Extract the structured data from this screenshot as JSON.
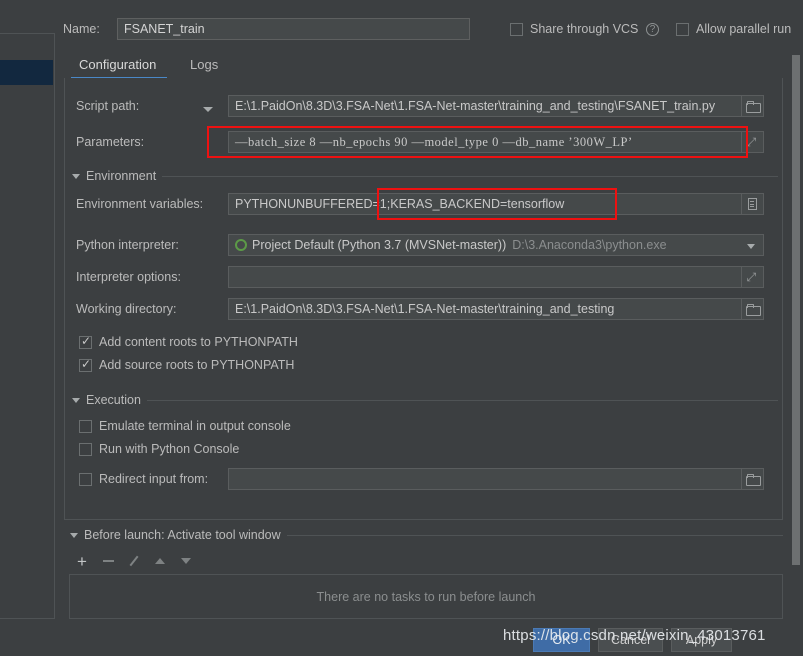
{
  "window": {
    "name_label": "Name:",
    "name_value": "FSANET_train",
    "share_vcs_label": "Share through VCS",
    "share_vcs_checked": false,
    "help_glyph": "?",
    "allow_parallel_label": "Allow parallel run",
    "allow_parallel_checked": false
  },
  "tabs": [
    {
      "label": "Configuration",
      "active": true
    },
    {
      "label": "Logs",
      "active": false
    }
  ],
  "configuration": {
    "script_path": {
      "label": "Script path:",
      "value": "E:\\1.PaidOn\\8.3D\\3.FSA-Net\\1.FSA-Net-master\\training_and_testing\\FSANET_train.py",
      "browse_icon": "folder-icon",
      "mode_caret": "chevron-down-icon"
    },
    "parameters": {
      "label": "Parameters:",
      "value": "—batch_size 8 —nb_epochs 90 —model_type 0 —db_name ’300W_LP’",
      "expand_icon": "expand-arrows-icon"
    },
    "environment_section": {
      "title": "Environment",
      "expanded": true
    },
    "env_vars": {
      "label": "Environment variables:",
      "value": "PYTHONUNBUFFERED=1;KERAS_BACKEND=tensorflow",
      "edit_icon": "env-list-icon"
    },
    "interpreter": {
      "label": "Python interpreter:",
      "value": "Project Default (Python 3.7 (MVSNet-master))",
      "value_path": "D:\\3.Anaconda3\\python.exe",
      "status_icon": "green-circle-icon",
      "caret": "chevron-down-icon"
    },
    "interpreter_options": {
      "label": "Interpreter options:",
      "value": "",
      "expand_icon": "expand-arrows-icon"
    },
    "working_directory": {
      "label": "Working directory:",
      "value": "E:\\1.PaidOn\\8.3D\\3.FSA-Net\\1.FSA-Net-master\\training_and_testing",
      "browse_icon": "folder-icon"
    },
    "checkboxes": [
      {
        "label": "Add content roots to PYTHONPATH",
        "checked": true
      },
      {
        "label": "Add source roots to PYTHONPATH",
        "checked": true
      }
    ],
    "execution_section": {
      "title": "Execution",
      "expanded": true
    },
    "execution_checkboxes": [
      {
        "label": "Emulate terminal in output console",
        "checked": false
      },
      {
        "label": "Run with Python Console",
        "checked": false
      }
    ],
    "redirect_input": {
      "label": "Redirect input from:",
      "checked": false,
      "value": "",
      "browse_icon": "folder-icon"
    }
  },
  "before_launch": {
    "title": "Before launch: Activate tool window",
    "expanded": true,
    "toolbar": [
      {
        "name": "add-button",
        "glyph": "+"
      },
      {
        "name": "remove-button",
        "glyph": "−"
      },
      {
        "name": "edit-button",
        "glyph": "✎"
      },
      {
        "name": "move-up-button",
        "glyph": "▲"
      },
      {
        "name": "move-down-button",
        "glyph": "▼"
      }
    ],
    "empty_text": "There are no tasks to run before launch"
  },
  "footer": {
    "ok_label": "OK",
    "cancel_label": "Cancel",
    "apply_label": "Apply"
  },
  "watermark": {
    "text": "https://blog.csdn.net/weixin_43013761"
  },
  "colors": {
    "background": "#3c3f41",
    "field_background": "#45494a",
    "accent_blue": "#4a88c7",
    "annotation_red": "#ee1111",
    "selected_item": "#12283f",
    "primary_button": "#3f6ca6"
  }
}
